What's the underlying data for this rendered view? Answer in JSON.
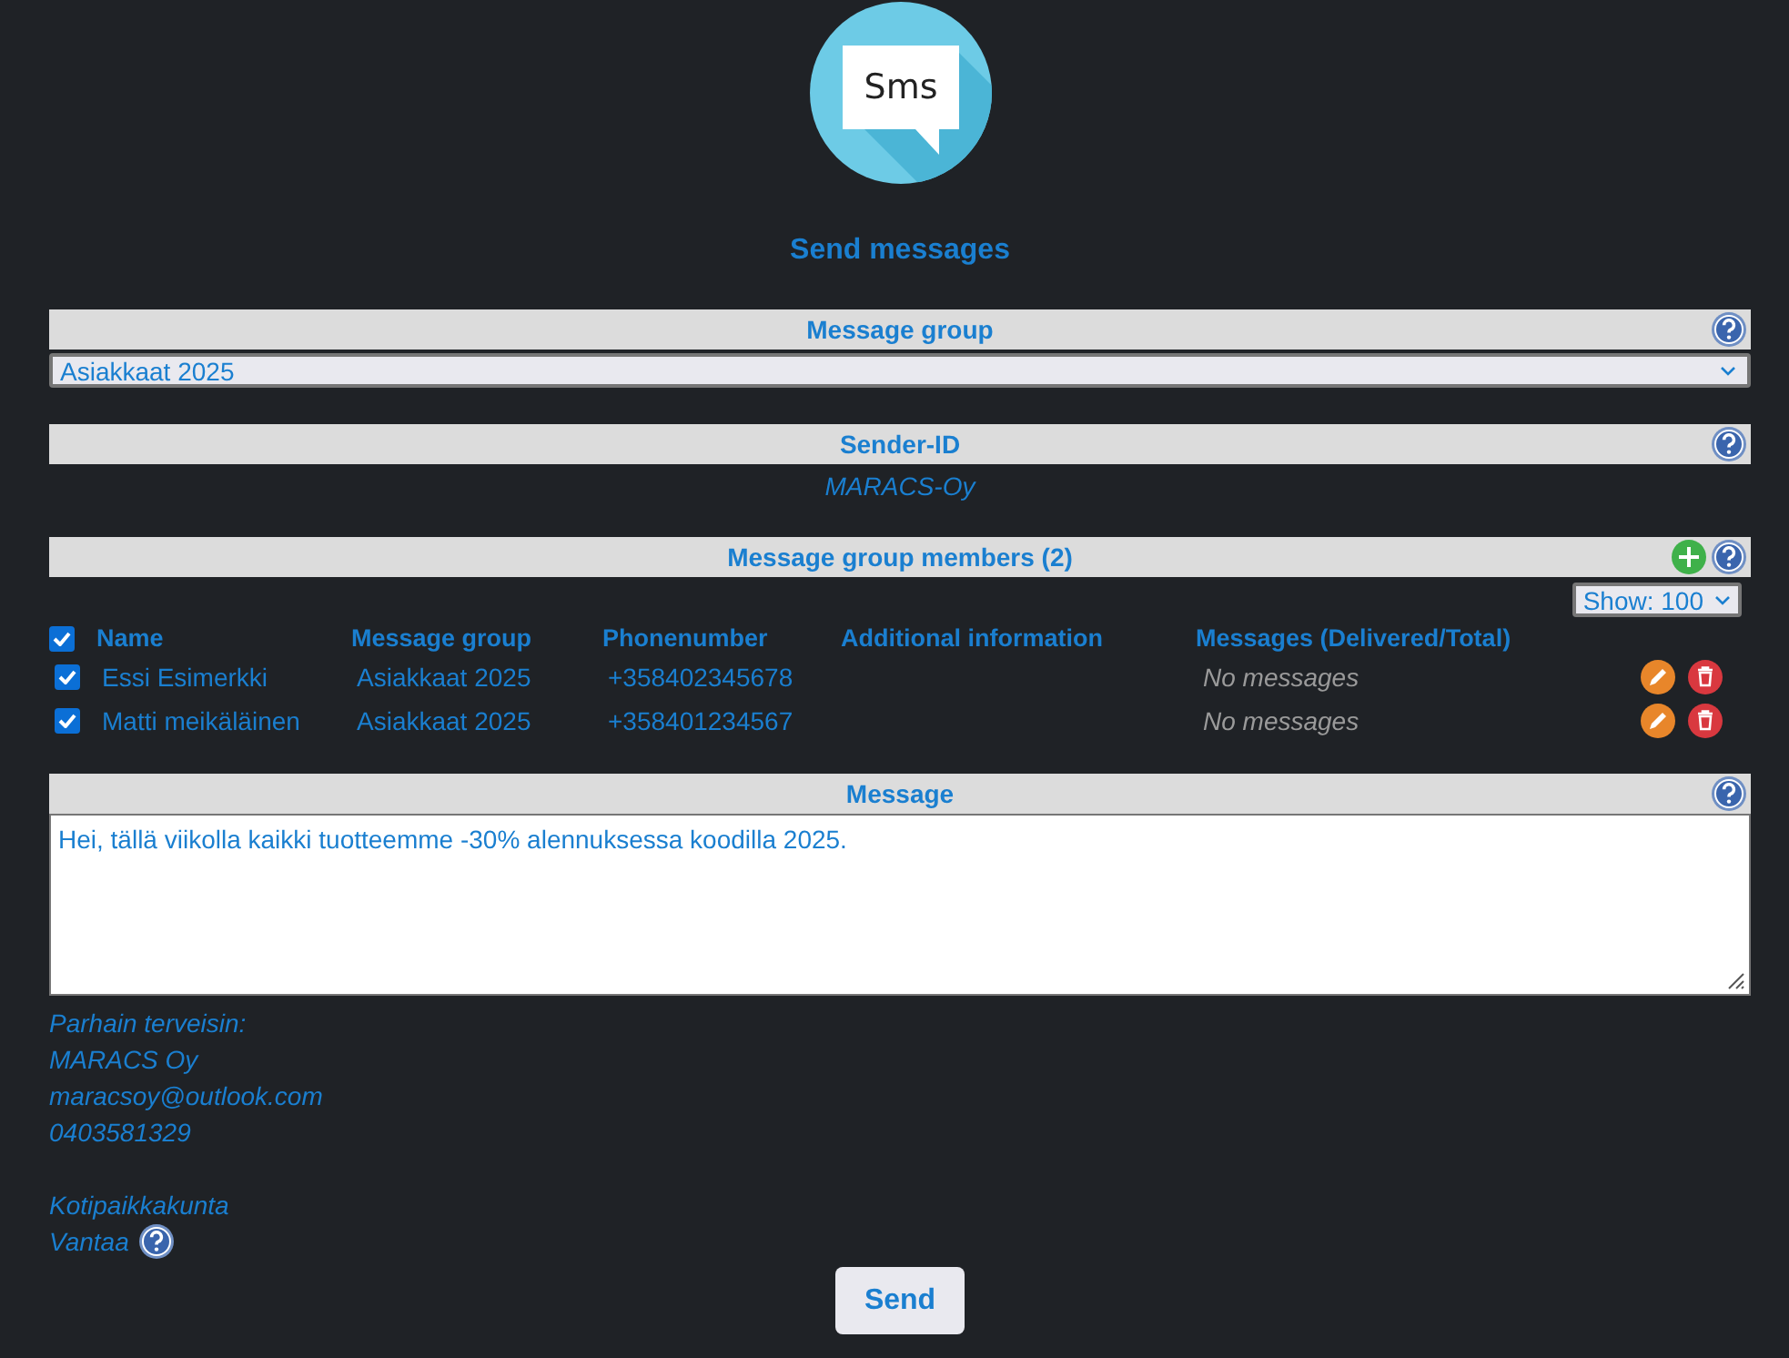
{
  "logo": {
    "text": "Sms"
  },
  "title": "Send messages",
  "message_group": {
    "header": "Message group",
    "help": true,
    "value": "Asiakkaat 2025"
  },
  "sender": {
    "header": "Sender-ID",
    "help": true,
    "value": "MARACS-Oy"
  },
  "members": {
    "header": "Message group members (2)",
    "help": true,
    "add": true,
    "show": "Show: 100",
    "select_all_checked": true,
    "columns": [
      "Name",
      "Message group",
      "Phonenumber",
      "Additional information",
      "Messages (Delivered/Total)"
    ],
    "rows": [
      {
        "checked": true,
        "name": "Essi Esimerkki",
        "group": "Asiakkaat 2025",
        "phone": "+358402345678",
        "messages": "No messages"
      },
      {
        "checked": true,
        "name": "Matti meikäläinen",
        "group": "Asiakkaat 2025",
        "phone": "+358401234567",
        "messages": "No messages"
      }
    ]
  },
  "message": {
    "header": "Message",
    "help": true,
    "value": "Hei, tällä viikolla kaikki tuotteemme -30% alennuksessa koodilla 2025."
  },
  "signature": {
    "blocks": [
      {
        "lines": [
          "Parhain terveisin:",
          "MARACS Oy",
          "maracsoy@outlook.com",
          "0403581329"
        ]
      },
      {
        "lines": [
          "Kotipaikkakunta",
          "Vantaa"
        ]
      }
    ],
    "help": true
  },
  "send_button": "Send"
}
